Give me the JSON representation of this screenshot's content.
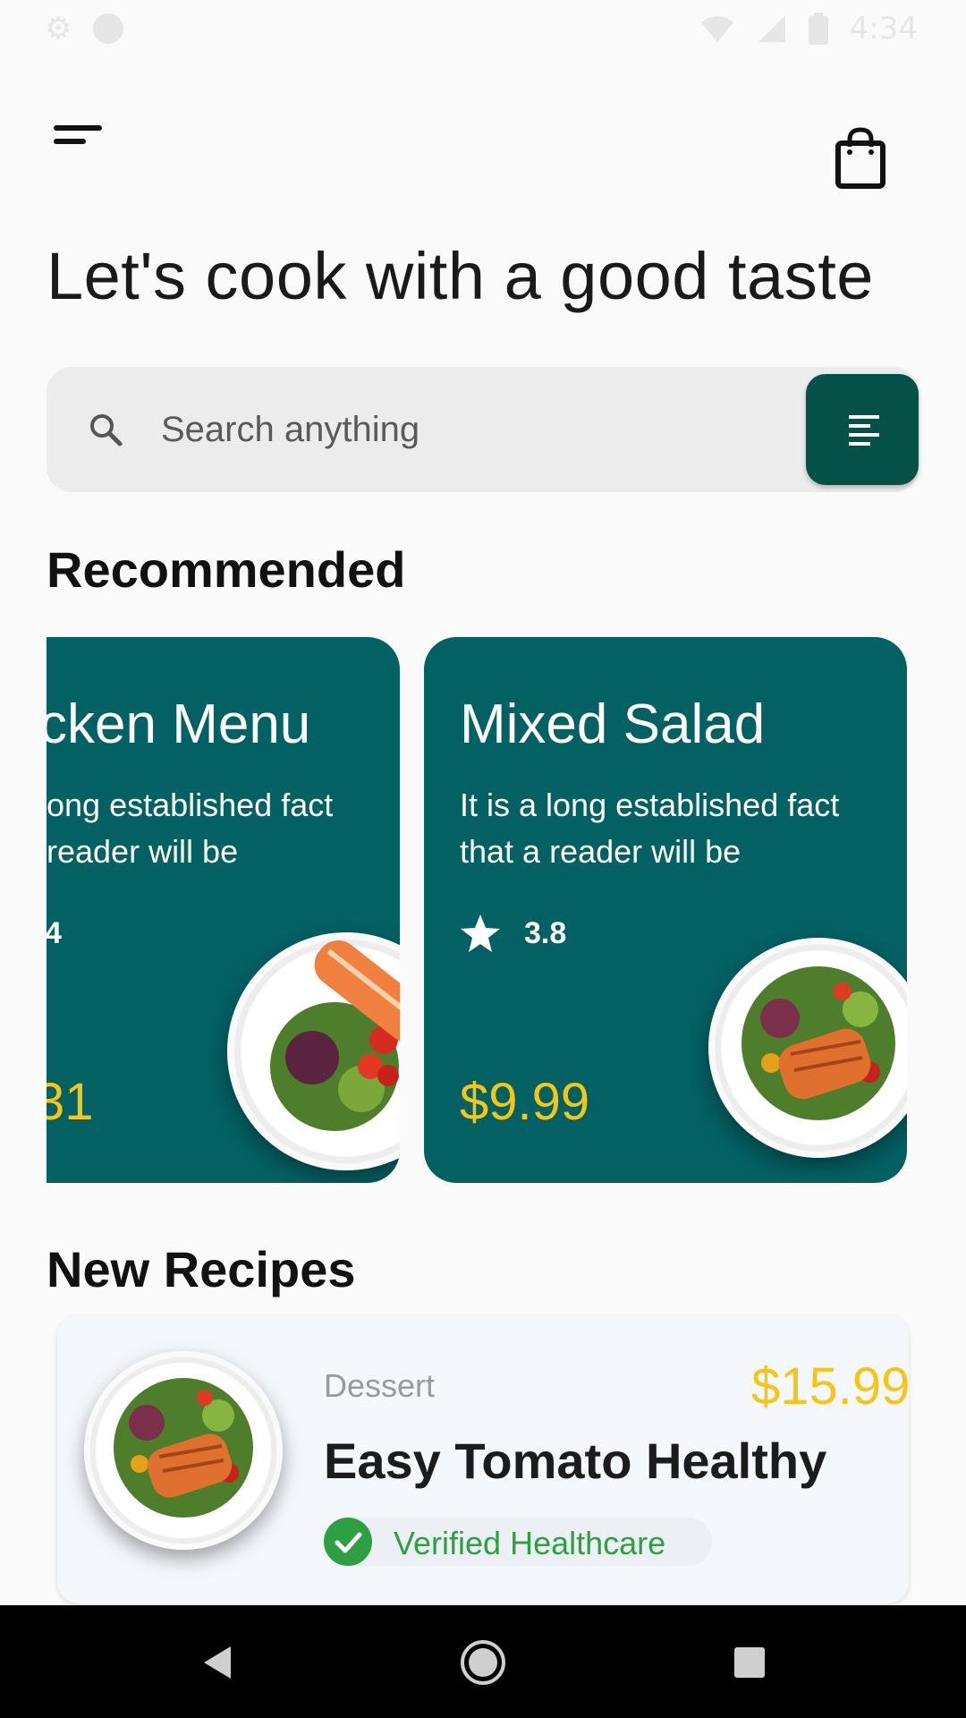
{
  "status_bar": {
    "time": "4:34",
    "icons": [
      "settings-icon",
      "circle-icon",
      "wifi-icon",
      "signal-icon",
      "battery-icon"
    ]
  },
  "header": {
    "menu_icon": "menu-icon",
    "cart_icon": "shopping-bag-icon"
  },
  "title": "Let's cook with a good taste",
  "search": {
    "placeholder": "Search anything",
    "icon": "search-icon",
    "filter_icon": "filter-icon"
  },
  "recommended": {
    "heading": "Recommended",
    "cards": [
      {
        "title": "cken Menu",
        "desc_lines": [
          "ong established fact",
          "reader will be"
        ],
        "rating": "4",
        "price": "31"
      },
      {
        "title": "Mixed Salad",
        "desc_lines": [
          "It is a long established fact",
          "that a reader will be"
        ],
        "rating": "3.8",
        "price": "$9.99"
      }
    ]
  },
  "new_recipes": {
    "heading": "New Recipes",
    "items": [
      {
        "category": "Dessert",
        "name": "Easy Tomato Healthy",
        "price": "$15.99",
        "badge": "Verified Healthcare"
      }
    ]
  },
  "colors": {
    "accent": "#045148",
    "card": "#036063",
    "price": "#F5C518",
    "verified": "#2EA043"
  }
}
